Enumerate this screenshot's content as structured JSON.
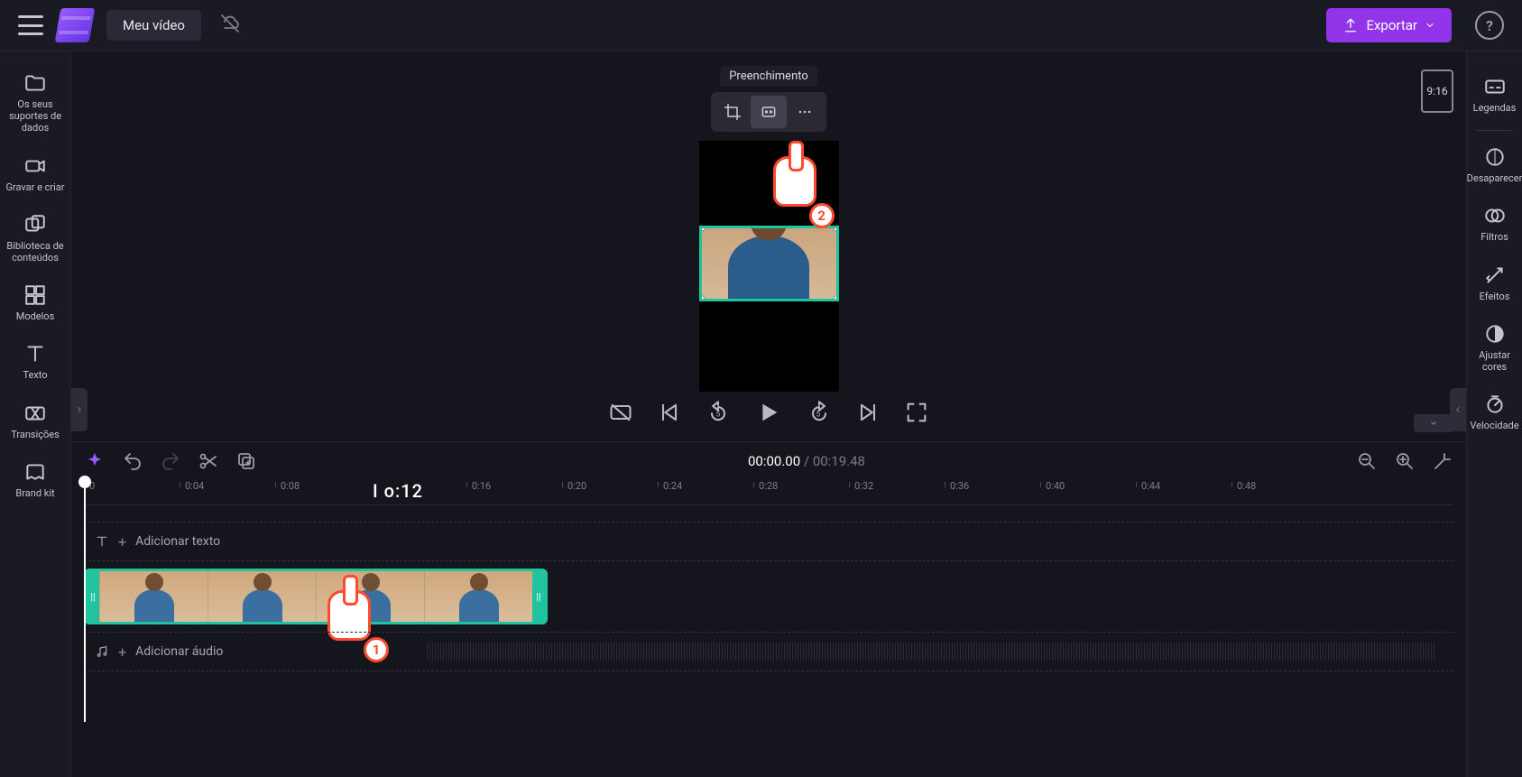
{
  "header": {
    "title": "Meu vídeo",
    "export_label": "Exportar"
  },
  "left_sidebar": {
    "items": [
      {
        "label": "Os seus suportes de dados"
      },
      {
        "label": "Gravar e criar"
      },
      {
        "label": "Biblioteca de conteúdos"
      },
      {
        "label": "Modelos"
      },
      {
        "label": "Texto"
      },
      {
        "label": "Transições"
      },
      {
        "label": "Brand kit"
      }
    ]
  },
  "right_sidebar": {
    "items": [
      {
        "label": "Legendas"
      },
      {
        "label": "Desaparecer"
      },
      {
        "label": "Filtros"
      },
      {
        "label": "Efeitos"
      },
      {
        "label": "Ajustar cores"
      },
      {
        "label": "Velocidade"
      }
    ]
  },
  "preview": {
    "tooltip": "Preenchimento",
    "aspect": "9:16",
    "cursor2": "2"
  },
  "timeline": {
    "current": "00:00.00",
    "sep": " / ",
    "duration": "00:19.48",
    "cursor_time": "I o:12",
    "ruler": [
      "0",
      "0:04",
      "0:08",
      "0:16",
      "0:20",
      "0:24",
      "0:28",
      "0:32",
      "0:36",
      "0:40",
      "0:44",
      "0:48"
    ],
    "text_track": "Adicionar texto",
    "audio_track": "Adicionar áudio",
    "cursor1": "1"
  }
}
